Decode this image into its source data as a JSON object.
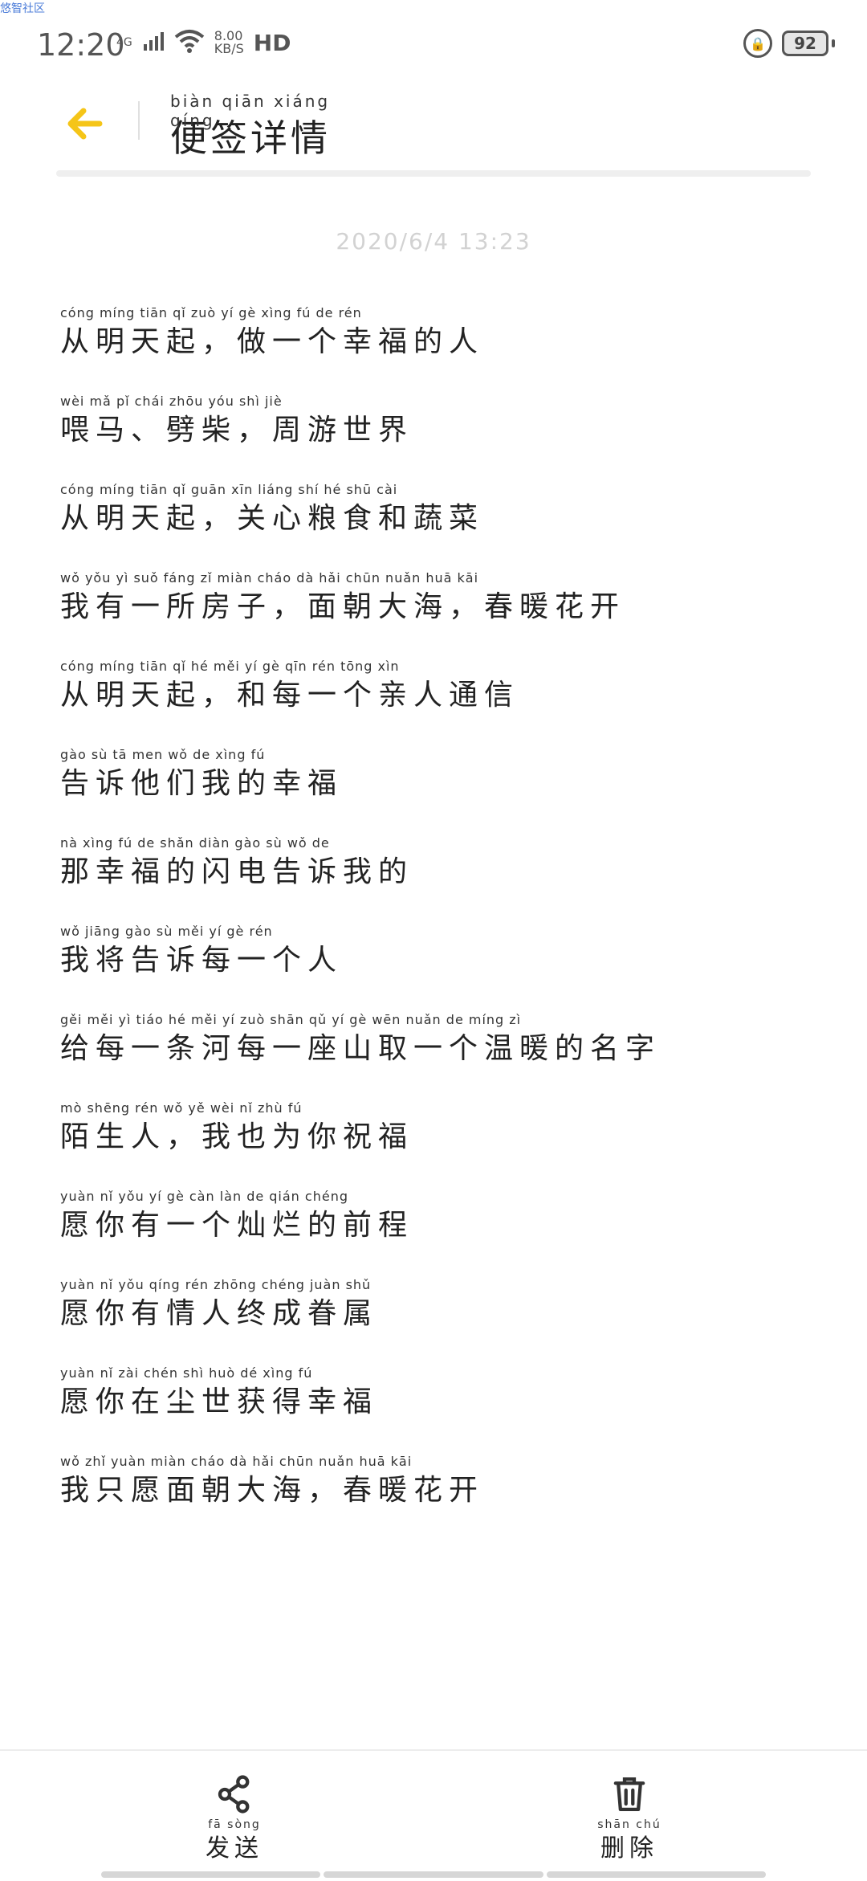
{
  "watermark": "悠智社区",
  "status_bar": {
    "time": "12:20",
    "network": "4G",
    "speed_value": "8.00",
    "speed_unit": "KB/S",
    "hd": "HD",
    "battery": "92"
  },
  "header": {
    "title": "便签详情",
    "title_pinyin": "biàn qiān xiáng qíng"
  },
  "note": {
    "timestamp": "2020/6/4 13:23",
    "lines": [
      {
        "pinyin": "cóng míng tiān qǐ    zuò  yí   gè  xìng  fú   de  rén",
        "text": "从明天起，做一个幸福的人"
      },
      {
        "pinyin": "wèi  mǎ      pǐ chái     zhōu yóu shì  jiè",
        "text": "喂马、劈柴，周游世界"
      },
      {
        "pinyin": "cóng míng tiān qǐ    guān xīn liáng shí  hé  shū  cài",
        "text": "从明天起，关心粮食和蔬菜"
      },
      {
        "pinyin": "wǒ yǒu  yì  suǒ fáng zǐ     miàn cháo dà  hǎi    chūn nuǎn huā kāi",
        "text": "我有一所房子，面朝大海，春暖花开"
      },
      {
        "pinyin": "cóng míng tiān qǐ     hé  měi  yí   gè  qīn  rén tōng xìn",
        "text": "从明天起，和每一个亲人通信"
      },
      {
        "pinyin": "gào  sù  tā  men  wǒ  de  xìng  fú",
        "text": "告诉他们我的幸福"
      },
      {
        "pinyin": "nà  xìng  fú  de  shǎn diàn gào  sù  wǒ  de",
        "text": "那幸福的闪电告诉我的"
      },
      {
        "pinyin": "wǒ jiāng gào  sù  měi  yí   gè  rén",
        "text": "我将告诉每一个人"
      },
      {
        "pinyin": "gěi měi  yì  tiáo  hé  měi  yí  zuò shān qǔ  yí   gè wēn nuǎn de míng zì",
        "text": "给每一条河每一座山取一个温暖的名字"
      },
      {
        "pinyin": "mò shēng rén      wǒ   yě  wèi  nǐ  zhù  fú",
        "text": "陌生人，我也为你祝福"
      },
      {
        "pinyin": "yuàn  nǐ  yǒu  yí   gè  càn  làn  de  qián chéng",
        "text": "愿你有一个灿烂的前程"
      },
      {
        "pinyin": "yuàn  nǐ  yǒu qíng rén zhōng chéng juàn shǔ",
        "text": "愿你有情人终成眷属"
      },
      {
        "pinyin": "yuàn  nǐ  zài chén shì huò  dé  xìng  fú",
        "text": "愿你在尘世获得幸福"
      },
      {
        "pinyin": "wǒ  zhǐ yuàn miàn cháo dà  hǎi     chūn nuǎn huā kāi",
        "text": "我只愿面朝大海，春暖花开"
      }
    ]
  },
  "bottom": {
    "send_pinyin": "fā sòng",
    "send_label": "发送",
    "delete_pinyin": "shān chú",
    "delete_label": "删除"
  },
  "colors": {
    "accent": "#F5C518",
    "timestamp": "#D2D2D2"
  },
  "icons": {
    "back": "arrow-left-icon",
    "share": "share-icon",
    "delete": "trash-icon"
  }
}
